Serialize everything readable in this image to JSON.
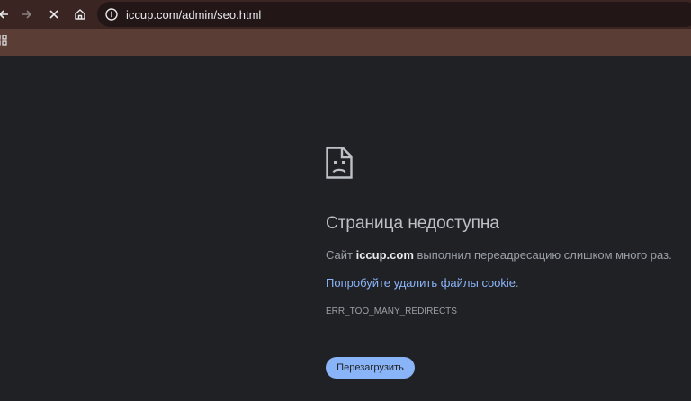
{
  "browser": {
    "url": "iccup.com/admin/seo.html",
    "colors": {
      "toolbar": "#3b2522",
      "omnibox": "#221616",
      "bookmarks_bar": "#5a3d35"
    }
  },
  "nav_icons": [
    "back-icon",
    "forward-icon",
    "stop-icon",
    "home-icon",
    "info-icon",
    "apps-icon"
  ],
  "error": {
    "icon": "sad-page-icon",
    "title": "Страница недоступна",
    "desc_prefix": "Сайт ",
    "site": "iccup.com",
    "desc_suffix": " выполнил переадресацию слишком много раз.",
    "link_text": "Попробуйте удалить файлы cookie",
    "link_suffix": ".",
    "code": "ERR_TOO_MANY_REDIRECTS",
    "reload_label": "Перезагрузить"
  },
  "colors": {
    "page_bg": "#202124",
    "title": "#bdc1c6",
    "text": "#9aa0a6",
    "link": "#8ab4f8",
    "button": "#8ab4f8"
  }
}
